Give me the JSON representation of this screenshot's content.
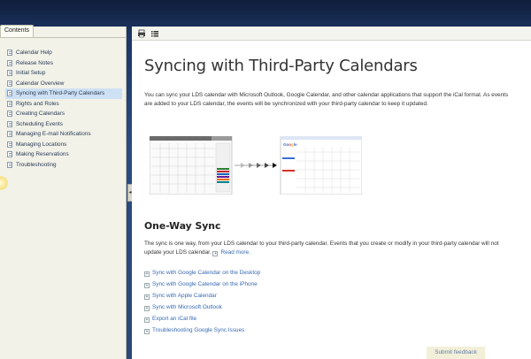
{
  "sidebar": {
    "tab_label": "Contents",
    "items": [
      {
        "label": "Calendar Help"
      },
      {
        "label": "Release Notes"
      },
      {
        "label": "Initial Setup"
      },
      {
        "label": "Calendar Overview"
      },
      {
        "label": "Syncing with Third-Party Calendars",
        "active": true
      },
      {
        "label": "Rights and Roles"
      },
      {
        "label": "Creating Calendars"
      },
      {
        "label": "Scheduling Events"
      },
      {
        "label": "Managing E-mail Notifications"
      },
      {
        "label": "Managing Locations"
      },
      {
        "label": "Making Reservations"
      },
      {
        "label": "Troubleshooting"
      }
    ],
    "collapse_glyph": "◂"
  },
  "toolbar": {
    "print_icon": "print-icon",
    "list_icon": "list-icon"
  },
  "article": {
    "title": "Syncing with Third-Party Calendars",
    "intro": "You can sync your LDS calendar with Microsoft Outlook, Google Calendar, and other calendar applications that support the iCal format. As events are added to your LDS calendar, the events will be synchronized with your third-party calendar to keep it updated.",
    "section_heading": "One-Way Sync",
    "section_text": "The sync is one way, from your LDS calendar to your third-party calendar. Events that you create or modify in your third-party calendar will not update your LDS calendar.",
    "read_more": "Read more.",
    "links": [
      "Sync with Google Calendar on the Desktop",
      "Sync with Google Calendar on the iPhone",
      "Sync with Apple Calendar",
      "Sync with Microsoft Outlook",
      "Export an iCal file",
      "Troubleshooting Google Sync Issues"
    ]
  },
  "feedback": {
    "label": "Submit feedback"
  },
  "colors": {
    "link": "#3769b3",
    "active_item": "#cde0f4",
    "panel_bg": "#f2f2e9"
  }
}
